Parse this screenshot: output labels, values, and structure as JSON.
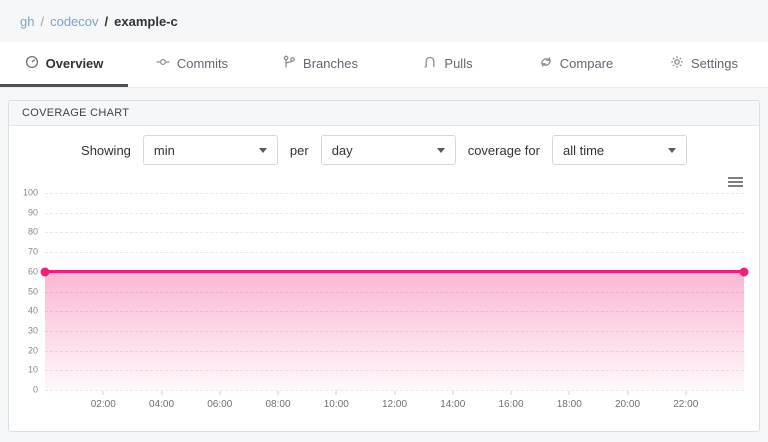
{
  "breadcrumb": {
    "org": "gh",
    "sep1": "/",
    "owner": "codecov",
    "sep2": "/",
    "repo": "example-c"
  },
  "tabs": [
    {
      "label": "Overview",
      "icon": "gauge-icon",
      "active": true
    },
    {
      "label": "Commits",
      "icon": "git-commit-icon",
      "active": false
    },
    {
      "label": "Branches",
      "icon": "git-branch-icon",
      "active": false
    },
    {
      "label": "Pulls",
      "icon": "git-pull-icon",
      "active": false
    },
    {
      "label": "Compare",
      "icon": "compare-icon",
      "active": false
    },
    {
      "label": "Settings",
      "icon": "gear-icon",
      "active": false
    }
  ],
  "panel": {
    "title": "COVERAGE CHART"
  },
  "controls": {
    "showing_label": "Showing",
    "showing_value": "min",
    "per_label": "per",
    "per_value": "day",
    "coverage_label": "coverage for",
    "range_value": "all time"
  },
  "chart_data": {
    "type": "area",
    "title": "Coverage chart",
    "series": [
      {
        "name": "min coverage per day",
        "color": "#f01f7a",
        "points": [
          {
            "x_hour": 0,
            "y": 60
          },
          {
            "x_hour": 24,
            "y": 60
          }
        ]
      }
    ],
    "x_axis": {
      "range_hours": [
        0,
        24
      ],
      "tick_hours": [
        2,
        4,
        6,
        8,
        10,
        12,
        14,
        16,
        18,
        20,
        22
      ],
      "tick_labels": [
        "02:00",
        "04:00",
        "06:00",
        "08:00",
        "10:00",
        "12:00",
        "14:00",
        "16:00",
        "18:00",
        "20:00",
        "22:00"
      ]
    },
    "y_axis": {
      "lim": [
        0,
        100
      ],
      "ticks": [
        0,
        10,
        20,
        30,
        40,
        50,
        60,
        70,
        80,
        90,
        100
      ]
    },
    "grid": "dashed-horizontal",
    "legend": "none",
    "fill_top": "rgba(240,31,122,0.32)",
    "fill_bottom": "rgba(240,31,122,0.03)"
  },
  "colors": {
    "accent_pink": "#f01f7a",
    "link_blue": "#7da3c9",
    "page_bg": "#f6f7f8"
  }
}
